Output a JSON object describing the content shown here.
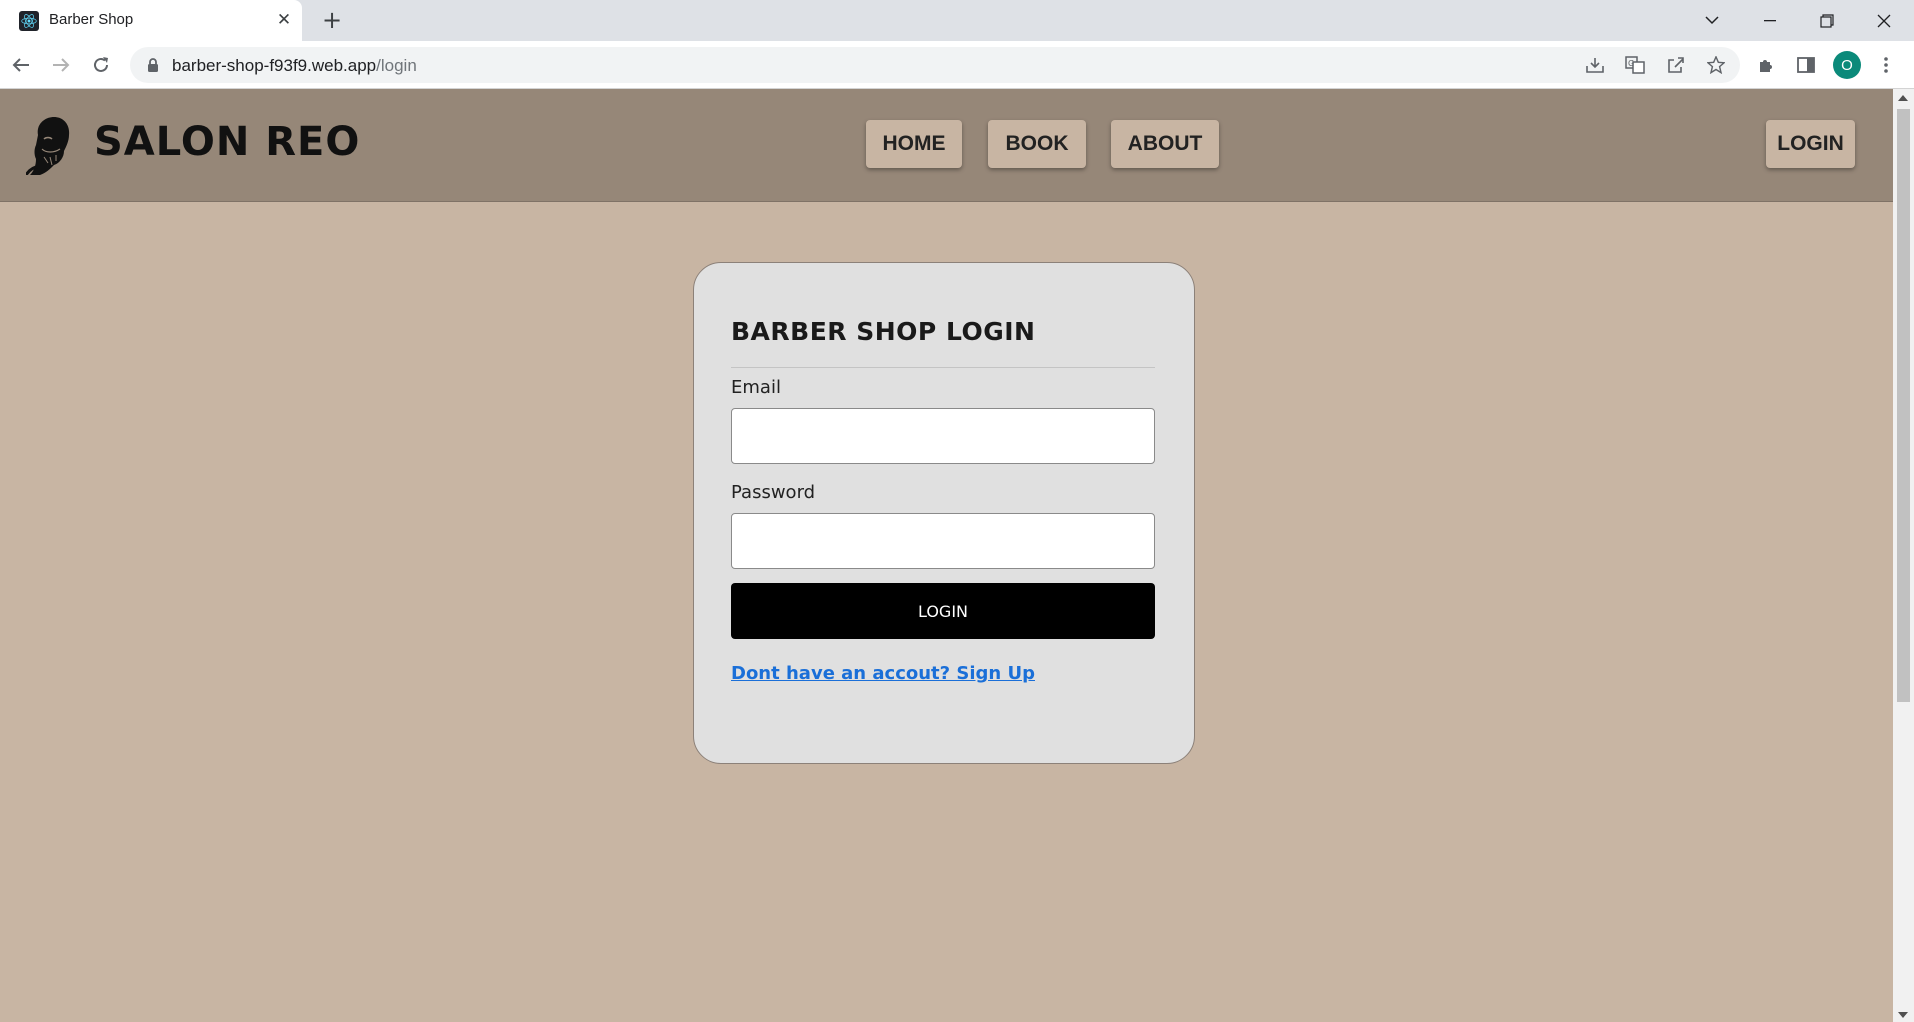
{
  "browser": {
    "tab_title": "Barber Shop",
    "url_host": "barber-shop-f93f9.web.app",
    "url_path": "/login",
    "profile_initial": "O"
  },
  "site": {
    "brand": "SALON REO",
    "nav": {
      "home": "HOME",
      "book": "BOOK",
      "about": "ABOUT",
      "login": "LOGIN"
    }
  },
  "login_form": {
    "title": "BARBER SHOP LOGIN",
    "email_label": "Email",
    "email_value": "",
    "password_label": "Password",
    "password_value": "",
    "submit_label": "LOGIN",
    "signup_link": "Dont have an accout? Sign Up"
  },
  "colors": {
    "page_bg": "#c8b5a3",
    "header_bg": "#968778",
    "card_bg": "#e0e0e0",
    "button_bg": "#000000",
    "link": "#1a6fd8"
  },
  "icons": [
    "react-favicon-icon",
    "close-icon",
    "plus-icon",
    "back-icon",
    "forward-icon",
    "reload-icon",
    "lock-icon",
    "install-icon",
    "translate-icon",
    "share-icon",
    "star-icon",
    "extensions-icon",
    "side-panel-icon",
    "menu-icon",
    "barber-logo-icon"
  ]
}
